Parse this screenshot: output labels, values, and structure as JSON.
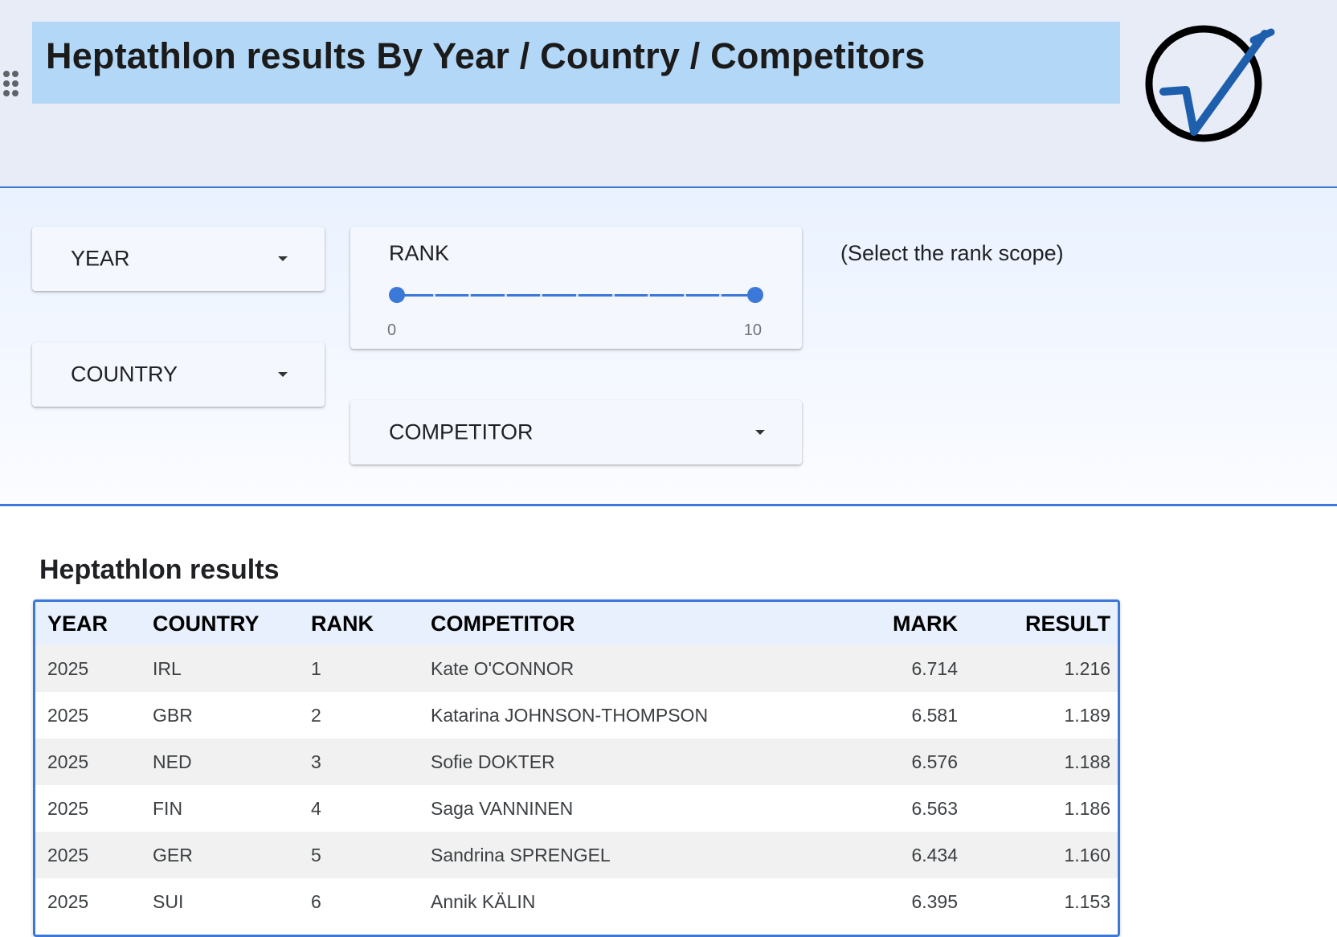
{
  "header": {
    "title": "Heptathlon results By Year / Country / Competitors",
    "logo_icon": "checkmark-circle-icon",
    "accent_color": "#3c78d8",
    "title_bg_color": "#b3d7f7"
  },
  "filters": {
    "year": {
      "label": "YEAR",
      "icon": "chevron-down-icon"
    },
    "country": {
      "label": "COUNTRY",
      "icon": "chevron-down-icon"
    },
    "competitor": {
      "label": "COMPETITOR",
      "icon": "chevron-down-icon"
    },
    "rank": {
      "label": "RANK",
      "min_label": "0",
      "max_label": "10",
      "min": 0,
      "max": 10,
      "selected_low": 0,
      "selected_high": 10
    },
    "rank_hint": "(Select the rank scope)"
  },
  "results": {
    "title": "Heptathlon results",
    "columns": [
      "YEAR",
      "COUNTRY",
      "RANK",
      "COMPETITOR",
      "MARK",
      "RESULT"
    ],
    "rows": [
      [
        "2025",
        "IRL",
        "1",
        "Kate O'CONNOR",
        "6.714",
        "1.216"
      ],
      [
        "2025",
        "GBR",
        "2",
        "Katarina JOHNSON-THOMPSON",
        "6.581",
        "1.189"
      ],
      [
        "2025",
        "NED",
        "3",
        "Sofie DOKTER",
        "6.576",
        "1.188"
      ],
      [
        "2025",
        "FIN",
        "4",
        "Saga VANNINEN",
        "6.563",
        "1.186"
      ],
      [
        "2025",
        "GER",
        "5",
        "Sandrina SPRENGEL",
        "6.434",
        "1.160"
      ],
      [
        "2025",
        "SUI",
        "6",
        "Annik KÄLIN",
        "6.395",
        "1.153"
      ]
    ]
  }
}
